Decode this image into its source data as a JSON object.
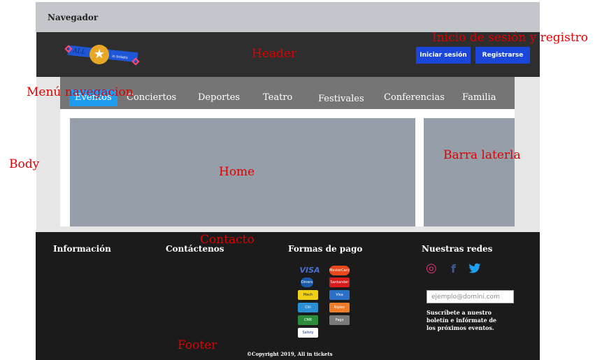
{
  "browser": {
    "title": "Navegador"
  },
  "header": {
    "logo": {
      "text1": "ALL",
      "text2": "in tickets",
      "star": "★"
    },
    "login_button": "Iniciar sesión",
    "register_button": "Registrarse"
  },
  "menu": {
    "items": [
      {
        "label": "Eventos"
      },
      {
        "label": "Conciertos"
      },
      {
        "label": "Deportes"
      },
      {
        "label": "Teatro"
      },
      {
        "label": "Festivales"
      },
      {
        "label": "Conferencias"
      },
      {
        "label": "Familia"
      }
    ],
    "active_index": 0
  },
  "footer": {
    "info_heading": "Información",
    "contact_heading": "Contáctenos",
    "payment_heading": "Formas de pago",
    "social_heading": "Nuestras redes",
    "payment_methods": [
      {
        "name": "VISA",
        "color": "#ffffff",
        "text": "#1a3fa0"
      },
      {
        "name": "MasterCard",
        "color": "#e8481c",
        "text": "#ffffff"
      },
      {
        "name": "Diners",
        "color": "#1b5aa8",
        "text": "#ffffff"
      },
      {
        "name": "Santander",
        "color": "#d61c1c",
        "text": "#ffffff"
      },
      {
        "name": "Mach",
        "color": "#f0d116",
        "text": "#222222"
      },
      {
        "name": "Visa",
        "color": "#2b6fc8",
        "text": "#ffffff"
      },
      {
        "name": "Citi",
        "color": "#2c8fd4",
        "text": "#ffffff"
      },
      {
        "name": "Ripley",
        "color": "#ee7b28",
        "text": "#ffffff"
      },
      {
        "name": "CMR",
        "color": "#2d8c3c",
        "text": "#ffffff"
      },
      {
        "name": "Pago efectivo",
        "color": "#7a7a7a",
        "text": "#ffffff"
      },
      {
        "name": "Safety",
        "color": "#ffffff",
        "text": "#1b3b8a"
      }
    ],
    "social": [
      {
        "name": "instagram-icon",
        "glyph": "◎",
        "color": "#d7377b"
      },
      {
        "name": "facebook-icon",
        "glyph": "f",
        "color": "#3b5998"
      },
      {
        "name": "twitter-icon",
        "glyph": "🐦",
        "color": "#1da1f2"
      }
    ],
    "email_placeholder": "ejemplo@domini.com",
    "newsletter_text": "Suscríbete a nuestro boletín e infórmate de los próximos eventos.",
    "copyright": "©Copyright 2019, All in tickets"
  },
  "annotations": {
    "login_register": "Inicio de sesión y registro",
    "header": "Header",
    "menu": "Menú navegacion",
    "body": "Body",
    "home": "Home",
    "sidebar": "Barra laterla",
    "contact": "Contacto",
    "footer": "Footer"
  },
  "colors": {
    "header_bg": "#2e2e2e",
    "button_blue": "#1a47d9",
    "menu_bg": "#757575",
    "active_tab": "#1e9cf0",
    "placeholder_gray": "#969ea9",
    "footer_bg": "#1b1b1b",
    "annotation_red": "#e00000"
  }
}
